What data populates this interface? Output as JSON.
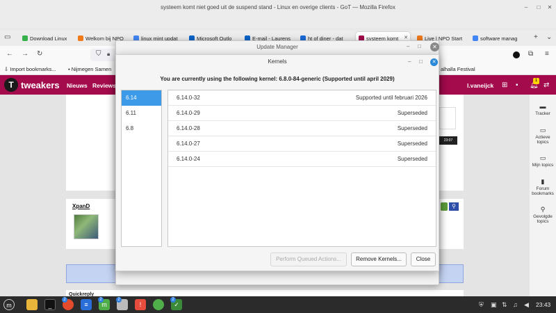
{
  "firefox": {
    "window_title": "systeem komt niet goed uit de suspend stand - Linux en overige clients - GoT — Mozilla Firefox",
    "tabs": [
      {
        "label": "Download Linux",
        "color": "#35b04a"
      },
      {
        "label": "Welkom bij NPO",
        "color": "#f07a1a"
      },
      {
        "label": "linux mint updat",
        "color": "#4285f4"
      },
      {
        "label": "Microsoft Outlo",
        "color": "#0a64c8"
      },
      {
        "label": "E-mail - Laurens",
        "color": "#0a64c8"
      },
      {
        "label": "ht of diner - dat",
        "color": "#1a6ad8"
      },
      {
        "label": "systeem komt",
        "color": "#a30b4c"
      },
      {
        "label": "Live | NPO Start",
        "color": "#f07a1a"
      },
      {
        "label": "software manag",
        "color": "#4285f4"
      }
    ],
    "bookmarks": [
      {
        "label": "Import bookmarks..."
      },
      {
        "label": "Nijmegen Samen"
      },
      {
        "label": "alhalla Festival"
      }
    ]
  },
  "tweakers": {
    "brand": "tweakers",
    "nav": [
      "Nieuws",
      "Reviews"
    ],
    "user": "l.vaneijck",
    "notification_count": "1",
    "video_time": "23:07",
    "post_author": "XpanD",
    "quickreply": "Quickreply",
    "sidebar": [
      {
        "label": "Tracker",
        "icon": "tracker-icon"
      },
      {
        "label": "Actieve topics",
        "icon": "chat-icon"
      },
      {
        "label": "Mijn topics",
        "icon": "chat-icon"
      },
      {
        "label": "Forum bookmarks",
        "icon": "bookmark-icon"
      },
      {
        "label": "Gevolgde topics",
        "icon": "pin-icon"
      }
    ]
  },
  "update_manager": {
    "title": "Update Manager"
  },
  "kernels": {
    "title": "Kernels",
    "current": "You are currently using the following kernel: 6.8.0-84-generic (Supported until april 2029)",
    "versions": [
      {
        "label": "6.14",
        "selected": true
      },
      {
        "label": "6.11",
        "selected": false
      },
      {
        "label": "6.8",
        "selected": false
      }
    ],
    "kernel_rows": [
      {
        "name": "6.14.0-32",
        "status": "Supported until februari 2026"
      },
      {
        "name": "6.14.0-29",
        "status": "Superseded"
      },
      {
        "name": "6.14.0-28",
        "status": "Superseded"
      },
      {
        "name": "6.14.0-27",
        "status": "Superseded"
      },
      {
        "name": "6.14.0-24",
        "status": "Superseded"
      }
    ],
    "buttons": {
      "perform": "Perform Queued Actions...",
      "remove": "Remove Kernels...",
      "close": "Close"
    }
  },
  "taskbar": {
    "clock": "23:43",
    "badges": [
      "2",
      "2",
      "2",
      "2"
    ]
  }
}
